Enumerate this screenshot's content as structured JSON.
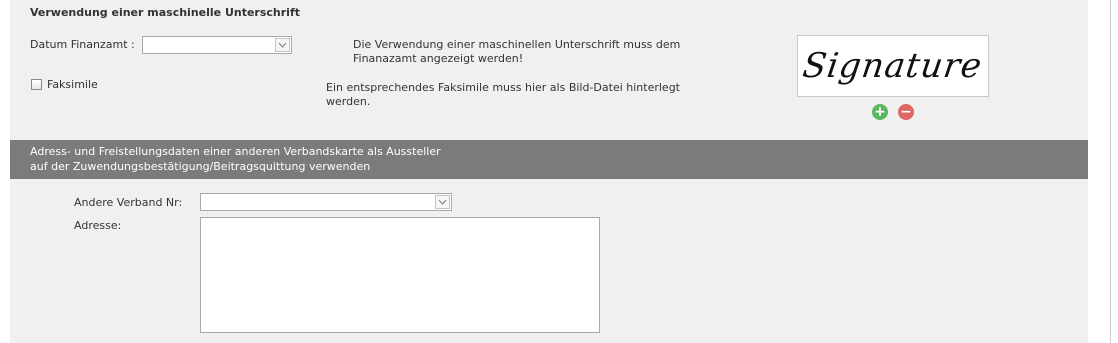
{
  "section": {
    "title": "Verwendung einer maschinelle Unterschrift"
  },
  "datum_finanzamt": {
    "label": "Datum Finanzamt :",
    "value": ""
  },
  "faksimile": {
    "label": "Faksimile",
    "checked": false
  },
  "info": {
    "line1": "Die Verwendung einer maschinellen Unterschrift muss dem",
    "line2": "Finanazamt angezeigt werden!",
    "line3": "Ein entsprechendes Faksimile muss hier als Bild-Datei hinterlegt",
    "line4": "werden."
  },
  "signature": {
    "image_text": "Signature",
    "add_icon": "plus-circle-icon",
    "remove_icon": "minus-circle-icon"
  },
  "banner": {
    "line1": "Adress- und Freistellungsdaten einer anderen Verbandskarte als Aussteller",
    "line2": "auf der Zuwendungsbestätigung/Beitragsquittung verwenden"
  },
  "andere_verband": {
    "label": "Andere Verband Nr:",
    "value": ""
  },
  "adresse": {
    "label": "Adresse:",
    "value": ""
  },
  "colors": {
    "panel": "#f0f0f0",
    "banner": "#7b7b7b",
    "add": "#5cb85c",
    "remove": "#e06666"
  }
}
